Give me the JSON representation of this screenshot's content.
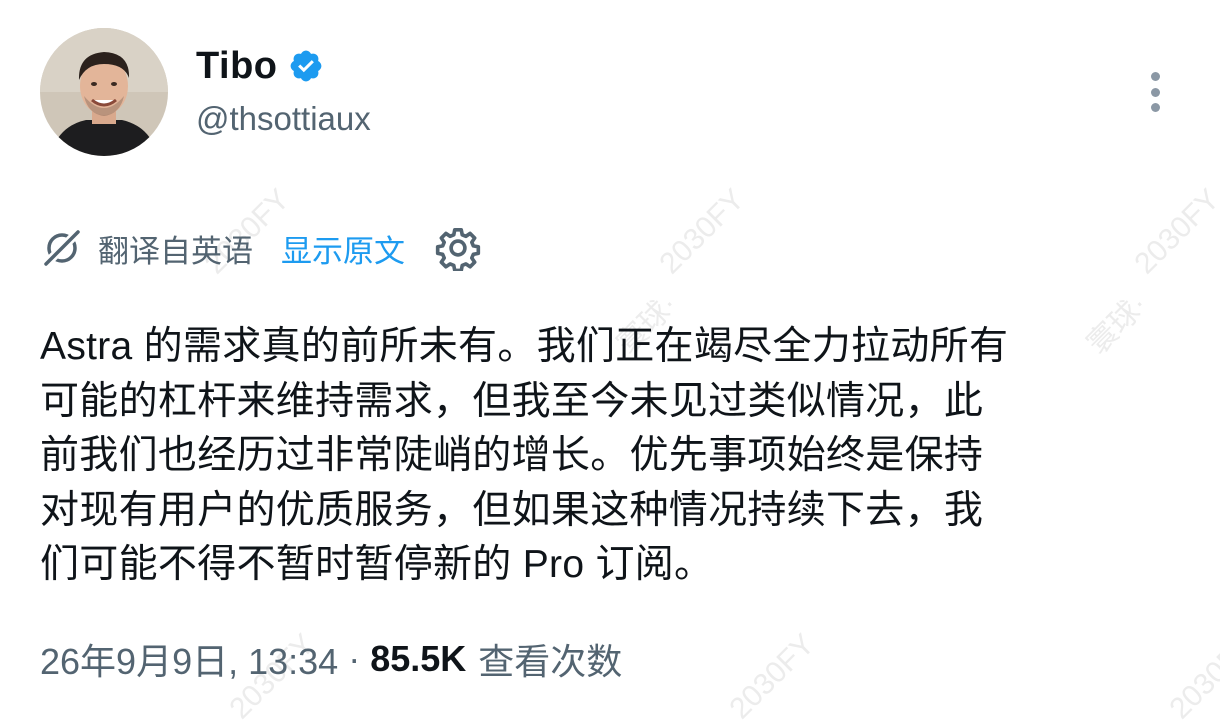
{
  "author": {
    "display_name": "Tibo",
    "handle": "@thsottiaux",
    "verified": true,
    "avatar_icon": "profile-photo"
  },
  "translation": {
    "translated_from": "翻译自英语",
    "show_original": "显示原文",
    "icon": "translate-icon",
    "settings_icon": "gear-icon"
  },
  "tweet": {
    "lines": [
      "Astra 的需求真的前所未有。我们正在竭尽全力拉动所有",
      "可能的杠杆来维持需求，但我至今未见过类似情况，此",
      "前我们也经历过非常陡峭的增长。优先事项始终是保持",
      "对现有用户的优质服务，但如果这种情况持续下去，我",
      "们可能不得不暂时暂停新的 Pro 订阅。"
    ]
  },
  "meta": {
    "timestamp": "26年9月9日, 13:34",
    "separator": "·",
    "views_count": "85.5K",
    "views_label": "查看次数"
  },
  "watermark": {
    "text": "2030FY",
    "prefix": "寰球·"
  },
  "colors": {
    "verified_blue": "#1d9bf0",
    "link_blue": "#1d9bf0",
    "secondary_text": "#536471",
    "primary_text": "#0f1419"
  }
}
